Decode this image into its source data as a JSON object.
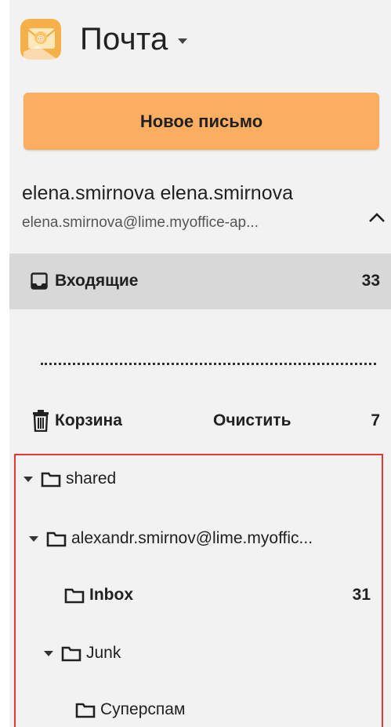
{
  "header": {
    "app_title": "Почта",
    "icons": {
      "logo": "mail-app-logo",
      "menu": "chevron-down-icon"
    }
  },
  "compose": {
    "new_letter_label": "Новое письмо"
  },
  "account": {
    "display_name": "elena.smirnova elena.smirnova",
    "email": "elena.smirnova@lime.myoffice-ap...",
    "collapse_icon": "chevron-up-icon"
  },
  "folders": {
    "inbox": {
      "label": "Входящие",
      "count": "33",
      "icon": "inbox-icon"
    },
    "trash": {
      "label": "Корзина",
      "action": "Очистить",
      "count": "7",
      "icon": "trash-icon"
    }
  },
  "shared": {
    "root_label": "shared",
    "user_label": "alexandr.smirnov@lime.myoffic...",
    "inbox_label": "Inbox",
    "inbox_count": "31",
    "junk_label": "Junk",
    "superspam_label": "Суперспам"
  },
  "colors": {
    "accent": "#fbae61",
    "highlight_border": "#e53935",
    "selected_row": "#d8d8d8",
    "panel_bg": "#f2f2f2"
  }
}
